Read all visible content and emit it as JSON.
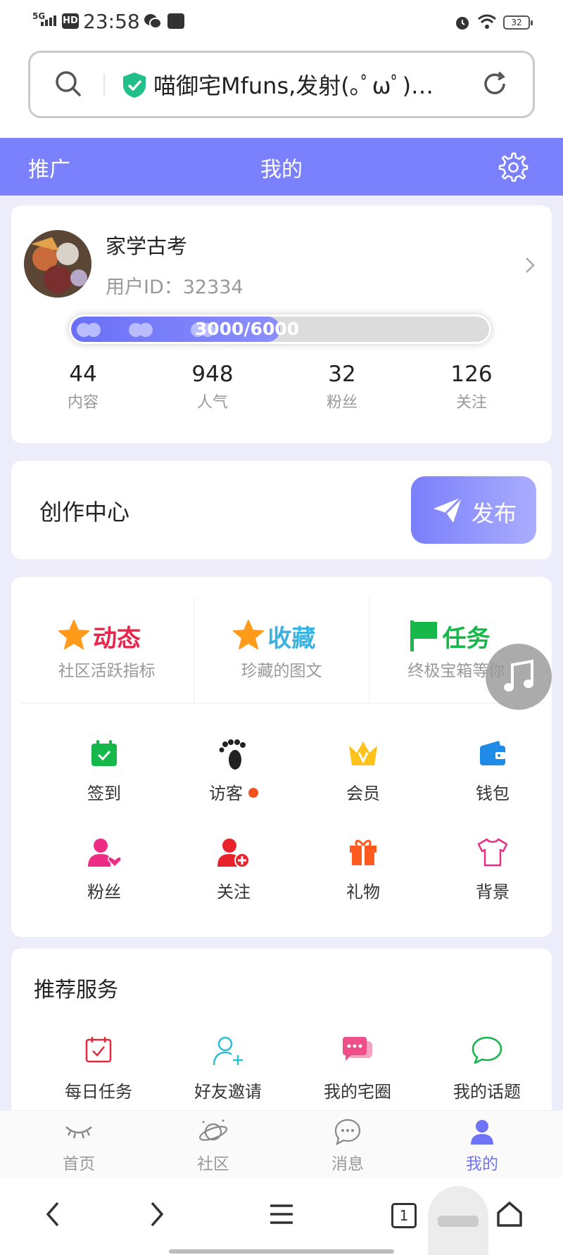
{
  "status_bar": {
    "network": "5G",
    "hd": "HD",
    "time": "23:58",
    "battery": "32"
  },
  "browser": {
    "url_text": "喵御宅Mfuns,发射(｡ﾟωﾟ)…",
    "tab_count": "1"
  },
  "top_nav": {
    "left": "推广",
    "center": "我的"
  },
  "profile": {
    "name": "家学古考",
    "user_id": "用户ID：32334",
    "xp_text": "3000/6000",
    "xp_fraction": 0.5,
    "stats": [
      {
        "value": "44",
        "label": "内容"
      },
      {
        "value": "948",
        "label": "人气"
      },
      {
        "value": "32",
        "label": "粉丝"
      },
      {
        "value": "126",
        "label": "关注"
      }
    ]
  },
  "creator": {
    "title": "创作中心",
    "publish_label": "发布"
  },
  "features": [
    {
      "title": "动态",
      "subtitle": "社区活跃指标",
      "color": "#e8254a",
      "icon": "star-icon"
    },
    {
      "title": "收藏",
      "subtitle": "珍藏的图文",
      "color": "#3ab3e0",
      "icon": "star-icon"
    },
    {
      "title": "任务",
      "subtitle": "终极宝箱等你",
      "color": "#16b84a",
      "icon": "flag-icon"
    }
  ],
  "grid": [
    {
      "label": "签到",
      "icon": "calendar-check-icon"
    },
    {
      "label": "访客",
      "icon": "footprints-icon",
      "badge": true
    },
    {
      "label": "会员",
      "icon": "crown-icon"
    },
    {
      "label": "钱包",
      "icon": "wallet-icon"
    },
    {
      "label": "粉丝",
      "icon": "fan-user-icon"
    },
    {
      "label": "关注",
      "icon": "follow-user-icon"
    },
    {
      "label": "礼物",
      "icon": "gift-icon"
    },
    {
      "label": "背景",
      "icon": "shirt-icon"
    }
  ],
  "services": {
    "title": "推荐服务",
    "items": [
      {
        "label": "每日任务",
        "icon": "calendar-task-icon"
      },
      {
        "label": "好友邀请",
        "icon": "invite-user-icon"
      },
      {
        "label": "我的宅圈",
        "icon": "chat-bubbles-icon"
      },
      {
        "label": "我的话题",
        "icon": "speech-bubble-icon"
      }
    ]
  },
  "tabbar": [
    {
      "label": "首页",
      "icon": "eye-closed-icon"
    },
    {
      "label": "社区",
      "icon": "planet-icon"
    },
    {
      "label": "消息",
      "icon": "message-icon"
    },
    {
      "label": "我的",
      "icon": "user-icon",
      "active": true
    }
  ],
  "colors": {
    "accent": "#7b80fc",
    "active_tab": "#6f74f6",
    "background": "#ececfb"
  }
}
